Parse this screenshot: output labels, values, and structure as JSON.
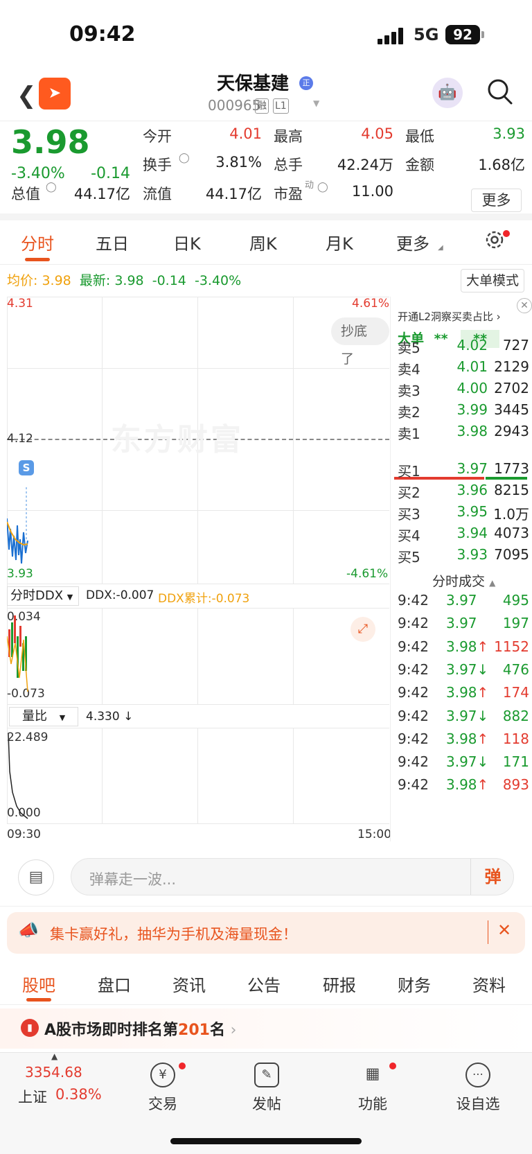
{
  "status": {
    "time": "09:42",
    "network": "5G",
    "battery": "92"
  },
  "header": {
    "name": "天保基建",
    "badge": "正",
    "code": "000965",
    "tag1": "融",
    "tag2": "L1"
  },
  "quote": {
    "price": "3.98",
    "pct": "-3.40%",
    "chg": "-0.14",
    "open_label": "今开",
    "open": "4.01",
    "high_label": "最高",
    "high": "4.05",
    "low_label": "最低",
    "low": "3.93",
    "turnover_label": "换手",
    "turnover": "3.81%",
    "vol_label": "总手",
    "vol": "42.24万",
    "amount_label": "金额",
    "amount": "1.68亿",
    "mcap_label": "总值",
    "mcap": "44.17亿",
    "float_label": "流值",
    "float": "44.17亿",
    "pe_label": "市盈",
    "pe_sup": "动",
    "pe": "11.00",
    "more": "更多"
  },
  "tabs": [
    "分时",
    "五日",
    "日K",
    "周K",
    "月K",
    "更多"
  ],
  "info": {
    "avg_label": "均价:",
    "avg": "3.98",
    "last_label": "最新:",
    "last": "3.98",
    "chg": "-0.14",
    "pct": "-3.40%",
    "mode_btn": "大单模式"
  },
  "chart": {
    "y_top": "4.31",
    "y_mid": "4.12",
    "y_bot": "3.93",
    "p_top": "4.61%",
    "p_bot": "-4.61%",
    "bubble": "抄底了",
    "s_marker": "S",
    "watermark": "东方财富",
    "ddx_select": "分时DDX",
    "ddx": "DDX:-0.007",
    "ddx_cum": "DDX累计:-0.073",
    "ddx_top": "0.034",
    "ddx_bot": "-0.073",
    "vr_select": "量比",
    "vr_val": "4.330 ↓",
    "vr_top": "22.489",
    "vr_bot": "0.000",
    "t_start": "09:30",
    "t_end": "15:00"
  },
  "orders": {
    "l2_title": "开通L2洞察买卖占比",
    "big_label": "大单",
    "big_v1": "**",
    "big_v2": "**",
    "asks": [
      {
        "label": "卖5",
        "price": "4.02",
        "vol": "727"
      },
      {
        "label": "卖4",
        "price": "4.01",
        "vol": "2129"
      },
      {
        "label": "卖3",
        "price": "4.00",
        "vol": "2702"
      },
      {
        "label": "卖2",
        "price": "3.99",
        "vol": "3445"
      },
      {
        "label": "卖1",
        "price": "3.98",
        "vol": "2943"
      }
    ],
    "bids": [
      {
        "label": "买1",
        "price": "3.97",
        "vol": "1773"
      },
      {
        "label": "买2",
        "price": "3.96",
        "vol": "8215"
      },
      {
        "label": "买3",
        "price": "3.95",
        "vol": "1.0万"
      },
      {
        "label": "买4",
        "price": "3.94",
        "vol": "4073"
      },
      {
        "label": "买5",
        "price": "3.93",
        "vol": "7095"
      }
    ],
    "ticks_title": "分时成交",
    "ticks": [
      {
        "t": "9:42",
        "p": "3.97",
        "d": "",
        "v": "495",
        "c": "green",
        "vc": "green"
      },
      {
        "t": "9:42",
        "p": "3.97",
        "d": "",
        "v": "197",
        "c": "green",
        "vc": "green"
      },
      {
        "t": "9:42",
        "p": "3.98",
        "d": "↑",
        "v": "1152",
        "c": "green",
        "vc": "red"
      },
      {
        "t": "9:42",
        "p": "3.97",
        "d": "↓",
        "v": "476",
        "c": "green",
        "vc": "green"
      },
      {
        "t": "9:42",
        "p": "3.98",
        "d": "↑",
        "v": "174",
        "c": "green",
        "vc": "red"
      },
      {
        "t": "9:42",
        "p": "3.97",
        "d": "↓",
        "v": "882",
        "c": "green",
        "vc": "green"
      },
      {
        "t": "9:42",
        "p": "3.98",
        "d": "↑",
        "v": "118",
        "c": "green",
        "vc": "red"
      },
      {
        "t": "9:42",
        "p": "3.97",
        "d": "↓",
        "v": "171",
        "c": "green",
        "vc": "green"
      },
      {
        "t": "9:42",
        "p": "3.98",
        "d": "↑",
        "v": "893",
        "c": "green",
        "vc": "red"
      }
    ]
  },
  "danmu": {
    "placeholder": "弹幕走一波...",
    "btn": "弹"
  },
  "banner": {
    "text": "集卡赢好礼，抽华为手机及海量现金！"
  },
  "bottom_tabs": [
    "股吧",
    "盘口",
    "资讯",
    "公告",
    "研报",
    "财务",
    "资料"
  ],
  "rank": {
    "prefix": "A股市场即时排名第",
    "num": "201",
    "suffix": "名"
  },
  "index": {
    "value": "3354.68",
    "name": "上证",
    "pct": "0.38%"
  },
  "nav": [
    {
      "label": "交易",
      "icon": "yen-icon"
    },
    {
      "label": "发帖",
      "icon": "edit-icon"
    },
    {
      "label": "功能",
      "icon": "apps-icon"
    },
    {
      "label": "设自选",
      "icon": "more-icon"
    }
  ]
}
